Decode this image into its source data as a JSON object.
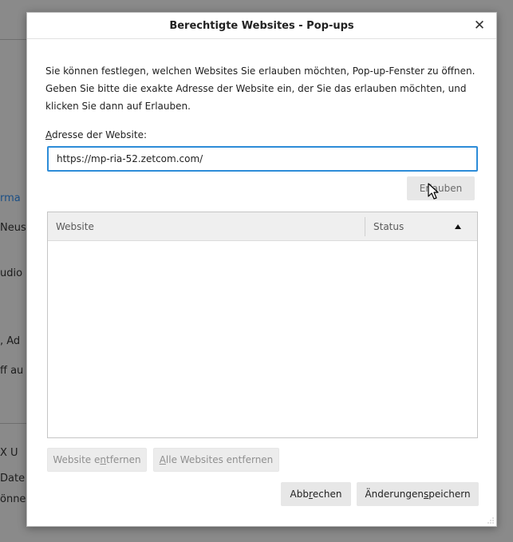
{
  "background": {
    "fragments": [
      "rma",
      "Neus",
      "udio",
      ", Ad",
      "ff au",
      "X U",
      "Date",
      "önne"
    ]
  },
  "dialog": {
    "title": "Berechtigte Websites - Pop-ups",
    "close_glyph": "✕",
    "intro_text": "Sie können festlegen, welchen Websites Sie erlauben möchten, Pop-up-Fenster zu öffnen. Geben Sie bitte die exakte Adresse der Website ein, der Sie das erlauben möchten, und klicken Sie dann auf Erlauben.",
    "address_label_first": "A",
    "address_label_rest": "dresse der Website:",
    "address_value": "https://mp-ria-52.zetcom.com/",
    "allow_button": {
      "pre": "Er",
      "key": "l",
      "post": "auben"
    },
    "table": {
      "col_website": "Website",
      "col_status": "Status",
      "sort_icon": "triangle-up-icon",
      "rows": []
    },
    "remove_button": {
      "pre": "Website e",
      "key": "n",
      "post": "tfernen"
    },
    "remove_all_button": {
      "pre": "",
      "key": "A",
      "post": "lle Websites entfernen"
    },
    "cancel_button": {
      "pre": "Abb",
      "key": "r",
      "post": "echen"
    },
    "save_button": {
      "pre": "Änderungen ",
      "key": "s",
      "post": "peichern"
    }
  },
  "colors": {
    "accent_focus": "#2d8cd8",
    "button_bg": "#e7e7e7",
    "overlay": "#8a8a8a"
  }
}
